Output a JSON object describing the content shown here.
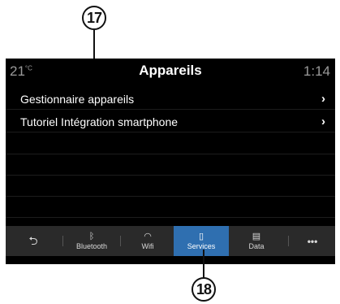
{
  "callouts": {
    "top": "17",
    "bottom": "18"
  },
  "header": {
    "temperature": "21",
    "temperature_unit": "°C",
    "title": "Appareils",
    "time": "1:14"
  },
  "menu": {
    "items": [
      {
        "label": "Gestionnaire appareils",
        "chevron": "›"
      },
      {
        "label": "Tutoriel Intégration smartphone",
        "chevron": "›"
      }
    ]
  },
  "tabs": [
    {
      "label": "",
      "icon": "back-icon"
    },
    {
      "label": "Bluetooth",
      "icon": "bluetooth-icon"
    },
    {
      "label": "Wifi",
      "icon": "wifi-icon"
    },
    {
      "label": "Services",
      "icon": "services-icon",
      "active": true
    },
    {
      "label": "Data",
      "icon": "data-icon"
    },
    {
      "label": "•••",
      "icon": "more-icon"
    }
  ],
  "colors": {
    "active_tab": "#2f6fb0",
    "screen_bg": "#000000",
    "tabbar_bg": "#2a2a2a"
  }
}
